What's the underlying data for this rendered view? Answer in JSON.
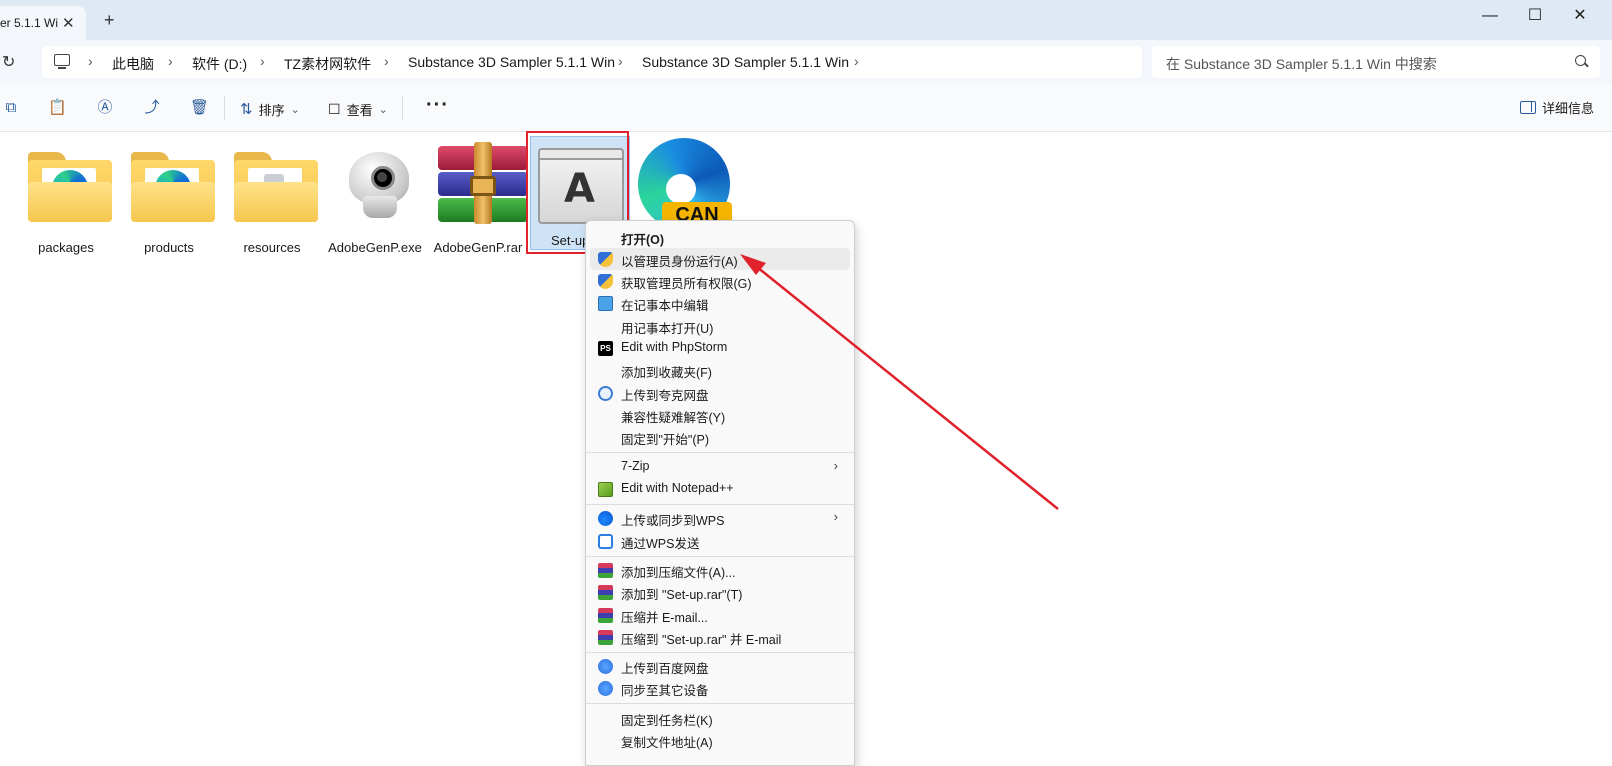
{
  "tab": {
    "label": "er 5.1.1 Wi",
    "close": "✕",
    "new": "+"
  },
  "window_controls": {
    "minimize": "—",
    "maximize": "☐",
    "close": "✕"
  },
  "addressbar": {
    "refresh": "↻",
    "crumbs": [
      "此电脑",
      "软件 (D:)",
      "TZ素材网软件",
      "Substance 3D Sampler 5.1.1 Win",
      "Substance 3D Sampler 5.1.1 Win"
    ],
    "chevron": "›"
  },
  "search": {
    "placeholder": "在 Substance 3D Sampler 5.1.1 Win 中搜索"
  },
  "toolbar": {
    "copy_icon": "⧉",
    "paste_icon": "📋",
    "rename_icon": "Ⓐ",
    "share_icon": "⤴",
    "delete_icon": "🗑",
    "sort_icon": "⇅",
    "sort_label": "排序",
    "view_icon": "☐",
    "view_label": "查看",
    "dropdown": "⌄",
    "more": "···",
    "details_label": "详细信息"
  },
  "files": [
    {
      "name": "packages"
    },
    {
      "name": "products"
    },
    {
      "name": "resources"
    },
    {
      "name": "AdobeGenP.exe"
    },
    {
      "name": "AdobeGenP.rar"
    },
    {
      "name": "Set-up"
    },
    {
      "name": "CAN"
    }
  ],
  "context_menu": {
    "items": [
      {
        "label": "打开(O)"
      },
      {
        "label": "以管理员身份运行(A)"
      },
      {
        "label": "获取管理员所有权限(G)"
      },
      {
        "label": "在记事本中编辑"
      },
      {
        "label": "用记事本打开(U)"
      },
      {
        "label": "Edit with PhpStorm"
      },
      {
        "label": "添加到收藏夹(F)"
      },
      {
        "label": "上传到夸克网盘"
      },
      {
        "label": "兼容性疑难解答(Y)"
      },
      {
        "label": "固定到\"开始\"(P)"
      },
      {
        "label": "7-Zip"
      },
      {
        "label": "Edit with Notepad++"
      },
      {
        "label": "上传或同步到WPS"
      },
      {
        "label": "通过WPS发送"
      },
      {
        "label": "添加到压缩文件(A)..."
      },
      {
        "label": "添加到 \"Set-up.rar\"(T)"
      },
      {
        "label": "压缩并 E-mail..."
      },
      {
        "label": "压缩到 \"Set-up.rar\" 并 E-mail"
      },
      {
        "label": "上传到百度网盘"
      },
      {
        "label": "同步至其它设备"
      },
      {
        "label": "固定到任务栏(K)"
      },
      {
        "label": "复制文件地址(A)"
      }
    ],
    "submenu_arrow": "›",
    "ps_icon_text": "PS"
  },
  "annotation": {
    "arrow_color": "#e0222c",
    "highlight_color": "#e0222c"
  }
}
